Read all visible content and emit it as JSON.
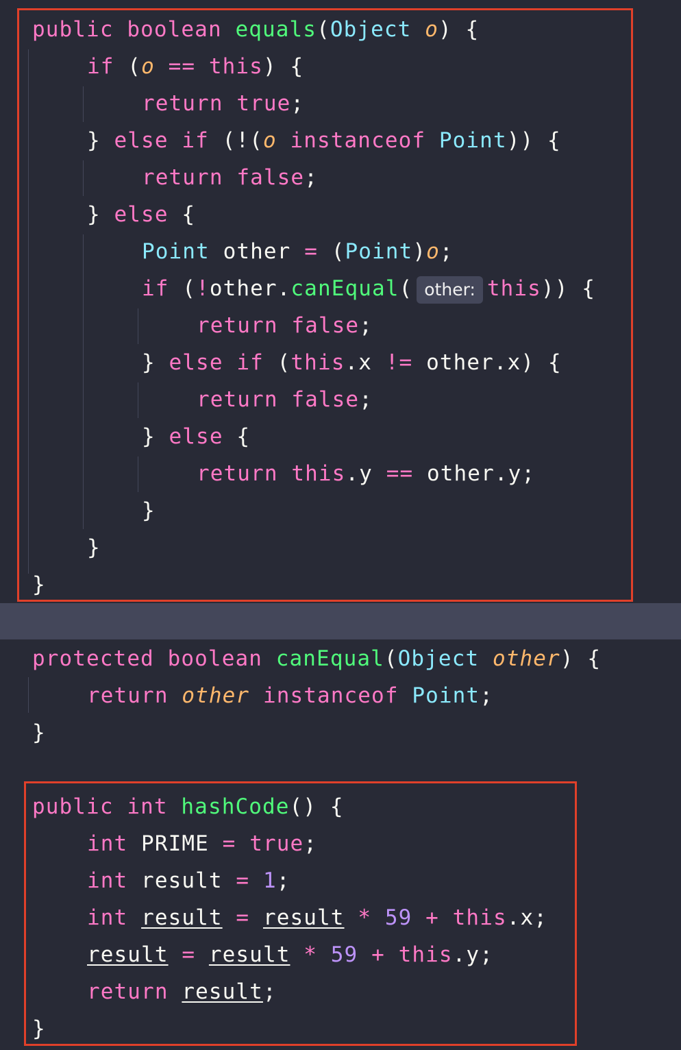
{
  "colors": {
    "background": "#282a36",
    "keyword": "#ff79c6",
    "function": "#50fa7b",
    "type": "#8be9fd",
    "parameter": "#ffb86c",
    "number": "#bd93f9",
    "plain": "#f8f8f2",
    "highlight_box": "#e0402a",
    "separator": "#44475a"
  },
  "equals_block": {
    "l1": {
      "public": "public",
      "boolean": "boolean",
      "name": "equals",
      "paren": "(",
      "type": "Object",
      "param": "o",
      "close": ") {"
    },
    "l2": {
      "if": "if",
      "p1": " (",
      "o": "o",
      "op": " == ",
      "this": "this",
      "p2": ") {"
    },
    "l3": {
      "return": "return",
      "val": "true",
      "semi": ";"
    },
    "l4": {
      "brace": "} ",
      "else": "else",
      "if": "if",
      "p1": " (!(",
      "o": "o",
      "instanceof": "instanceof",
      "type": "Point",
      "p2": ")) {"
    },
    "l5": {
      "return": "return",
      "val": "false",
      "semi": ";"
    },
    "l6": {
      "brace": "} ",
      "else": "else",
      "open": " {"
    },
    "l7": {
      "type": "Point",
      "var": " other ",
      "eq": "=",
      "p1": " (",
      "cast": "Point",
      "p2": ")",
      "o": "o",
      "semi": ";"
    },
    "l8": {
      "if": "if",
      "p1": " (",
      "not": "!",
      "obj": "other.",
      "method": "canEqual",
      "p2": "(",
      "hint": "other:",
      "this": "this",
      "p3": ")) {"
    },
    "l9": {
      "return": "return",
      "val": "false",
      "semi": ";"
    },
    "l10": {
      "brace": "} ",
      "else": "else",
      "if": "if",
      "p1": " (",
      "this": "this",
      "field": ".x ",
      "op": "!=",
      "rest": " other.x) {"
    },
    "l11": {
      "return": "return",
      "val": "false",
      "semi": ";"
    },
    "l12": {
      "brace": "} ",
      "else": "else",
      "open": " {"
    },
    "l13": {
      "return": "return",
      "this": "this",
      "field": ".y ",
      "op": "==",
      "rest": " other.y;"
    },
    "l14": "}",
    "l15": "}",
    "l16": "}"
  },
  "canequal_block": {
    "l1": {
      "protected": "protected",
      "boolean": "boolean",
      "name": "canEqual",
      "paren": "(",
      "type": "Object",
      "param": "other",
      "close": ") {"
    },
    "l2": {
      "return": "return",
      "param": "other",
      "instanceof": "instanceof",
      "type": "Point",
      "semi": ";"
    },
    "l3": "}"
  },
  "hashcode_block": {
    "l1": {
      "public": "public",
      "int": "int",
      "name": "hashCode",
      "close": "() {"
    },
    "l2": {
      "int": "int",
      "var": " PRIME ",
      "eq": "=",
      "val": "true",
      "semi": ";"
    },
    "l3": {
      "int": "int",
      "var": " result ",
      "eq": "=",
      "num": "1",
      "semi": ";"
    },
    "l4": {
      "int": "int",
      "var": "result",
      "eq": "=",
      "var2": "result",
      "mul": "*",
      "num": "59",
      "plus": "+",
      "this": "this",
      "rest": ".x;"
    },
    "l5": {
      "var": "result",
      "eq": "=",
      "var2": "result",
      "mul": "*",
      "num": "59",
      "plus": "+",
      "this": "this",
      "rest": ".y;"
    },
    "l6": {
      "return": "return",
      "var": "result",
      "semi": ";"
    },
    "l7": "}"
  }
}
